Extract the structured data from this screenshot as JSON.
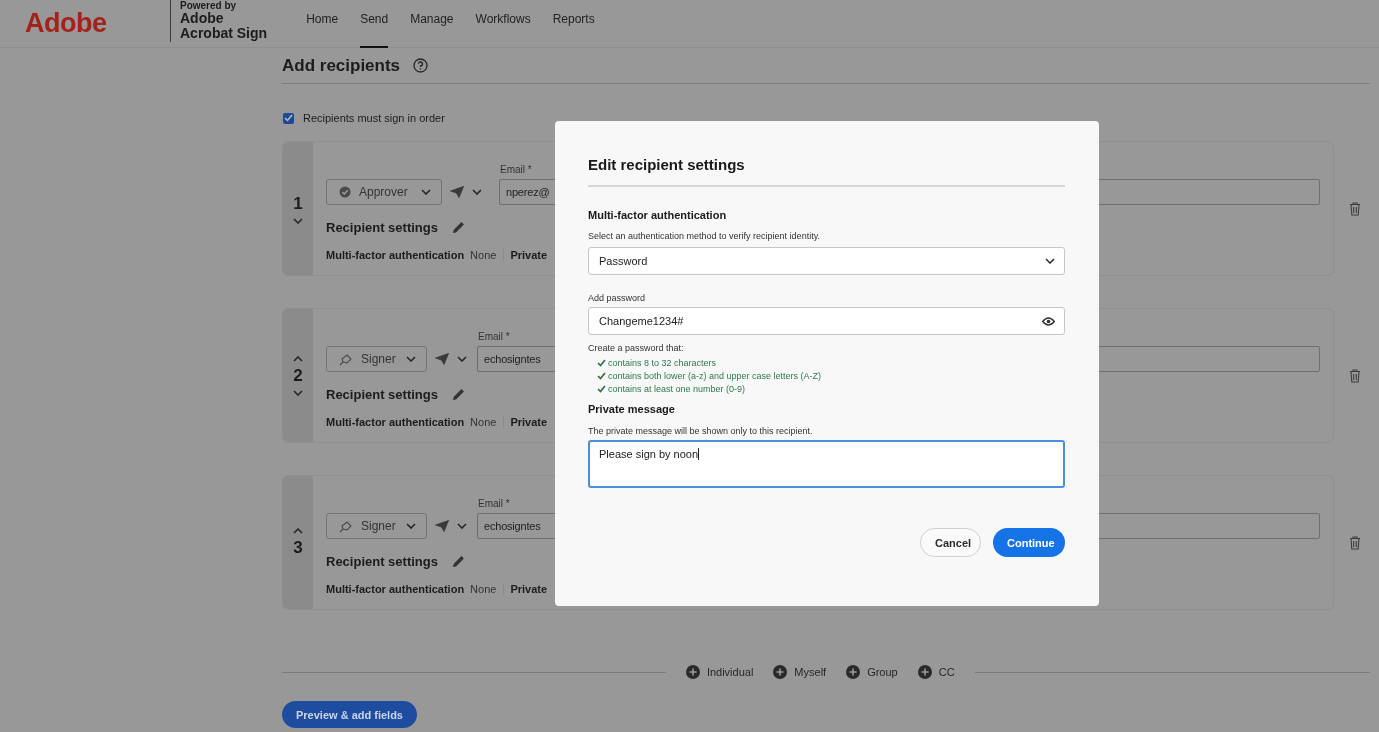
{
  "header": {
    "logo": "Adobe",
    "powered_by": "Powered by",
    "product_line1": "Adobe",
    "product_line2": "Acrobat Sign",
    "nav": [
      {
        "label": "Home",
        "selected": false
      },
      {
        "label": "Send",
        "selected": true
      },
      {
        "label": "Manage",
        "selected": false
      },
      {
        "label": "Workflows",
        "selected": false
      },
      {
        "label": "Reports",
        "selected": false
      }
    ]
  },
  "page": {
    "title": "Add recipients",
    "sign_in_order": {
      "label": "Recipients must sign in order",
      "checked": true
    },
    "recipients": [
      {
        "number": "1",
        "can_move_up": false,
        "can_move_down": true,
        "role": "Approver",
        "kind": "approver",
        "email_label": "Email *",
        "email": "nperez@",
        "settings_title": "Recipient settings",
        "mfa_label": "Multi-factor authentication",
        "mfa_value": "None",
        "private_label": "Private"
      },
      {
        "number": "2",
        "can_move_up": true,
        "can_move_down": true,
        "role": "Signer",
        "kind": "signer",
        "email_label": "Email *",
        "email": "echosigntes",
        "settings_title": "Recipient settings",
        "mfa_label": "Multi-factor authentication",
        "mfa_value": "None",
        "private_label": "Private"
      },
      {
        "number": "3",
        "can_move_up": true,
        "can_move_down": false,
        "role": "Signer",
        "kind": "signer",
        "email_label": "Email *",
        "email": "echosigntes",
        "settings_title": "Recipient settings",
        "mfa_label": "Multi-factor authentication",
        "mfa_value": "None",
        "private_label": "Private"
      }
    ],
    "add_options": [
      "Individual",
      "Myself",
      "Group",
      "CC"
    ],
    "primary_button": "Preview & add fields"
  },
  "dialog": {
    "title": "Edit recipient settings",
    "mfa_heading": "Multi-factor authentication",
    "mfa_help": "Select an authentication method to verify recipient identity.",
    "method": "Password",
    "password_label": "Add password",
    "password": "Changeme1234#",
    "rules_intro": "Create a password that:",
    "rules": [
      {
        "text": "contains 8 to 32 characters",
        "met": true
      },
      {
        "text": "contains both lower (a-z) and upper case letters (A-Z)",
        "met": true
      },
      {
        "text": "contains at least one number (0-9)",
        "met": true
      }
    ],
    "message_heading": "Private message",
    "message_help": "The private message will be shown only to this recipient.",
    "message": "Please sign by noon",
    "message_focused": true,
    "buttons": [
      "Cancel",
      "Continue"
    ]
  }
}
